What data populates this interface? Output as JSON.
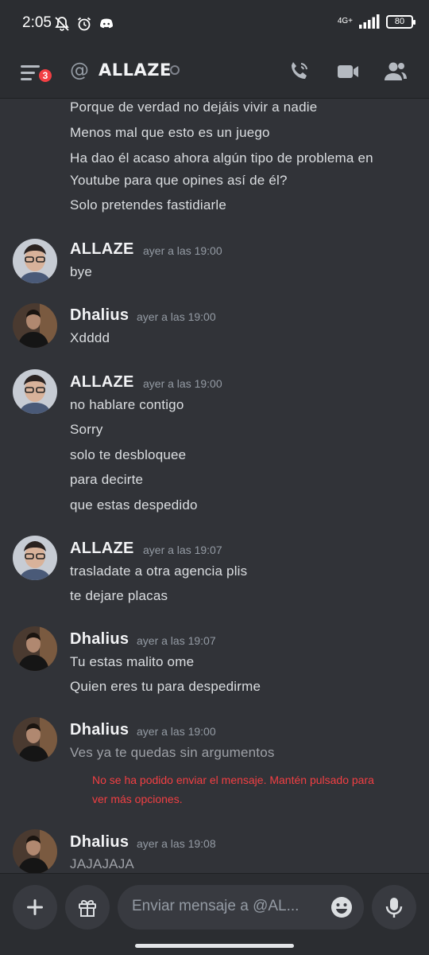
{
  "status_bar": {
    "time": "2:05",
    "network": "4G+",
    "battery": "80"
  },
  "header": {
    "badge_count": "3",
    "at_symbol": "@",
    "title": "ALLAZE"
  },
  "messages": {
    "continuation_lines": [
      "Porque de verdad no dejáis vivir a nadie",
      "Menos mal que esto es un juego",
      "Ha dao él acaso ahora algún tipo de problema en",
      "Youtube para que opines así de él?",
      "Solo pretendes fastidiarle"
    ],
    "groups": [
      {
        "author": "ALLAZE",
        "timestamp": "ayer a las 19:00",
        "lines": [
          "bye"
        ]
      },
      {
        "author": "Dhalius",
        "timestamp": "ayer a las 19:00",
        "lines": [
          "Xdddd"
        ]
      },
      {
        "author": "ALLAZE",
        "timestamp": "ayer a las 19:00",
        "lines": [
          "no hablare contigo",
          "Sorry",
          "solo te desbloquee",
          "para decirte",
          "que estas despedido"
        ]
      },
      {
        "author": "ALLAZE",
        "timestamp": "ayer a las 19:07",
        "lines": [
          "trasladate a otra agencia plis",
          "te dejare placas"
        ]
      },
      {
        "author": "Dhalius",
        "timestamp": "ayer a las 19:07",
        "lines": [
          "Tu estas malito ome",
          "Quien eres tu para despedirme"
        ]
      },
      {
        "author": "Dhalius",
        "timestamp": "ayer a las 19:00",
        "lines": [
          "Ves ya te quedas sin argumentos"
        ],
        "error": [
          "No se ha podido enviar el mensaje. Mantén pulsado para",
          "ver más opciones."
        ]
      },
      {
        "author": "Dhalius",
        "timestamp": "ayer a las 19:08",
        "lines": [
          "JAJAJAJA"
        ]
      }
    ]
  },
  "composer": {
    "placeholder": "Enviar mensaje a @AL..."
  },
  "colors": {
    "background": "#313338",
    "bars": "#2b2d31",
    "error": "#f23f43",
    "badge": "#f23f43"
  }
}
